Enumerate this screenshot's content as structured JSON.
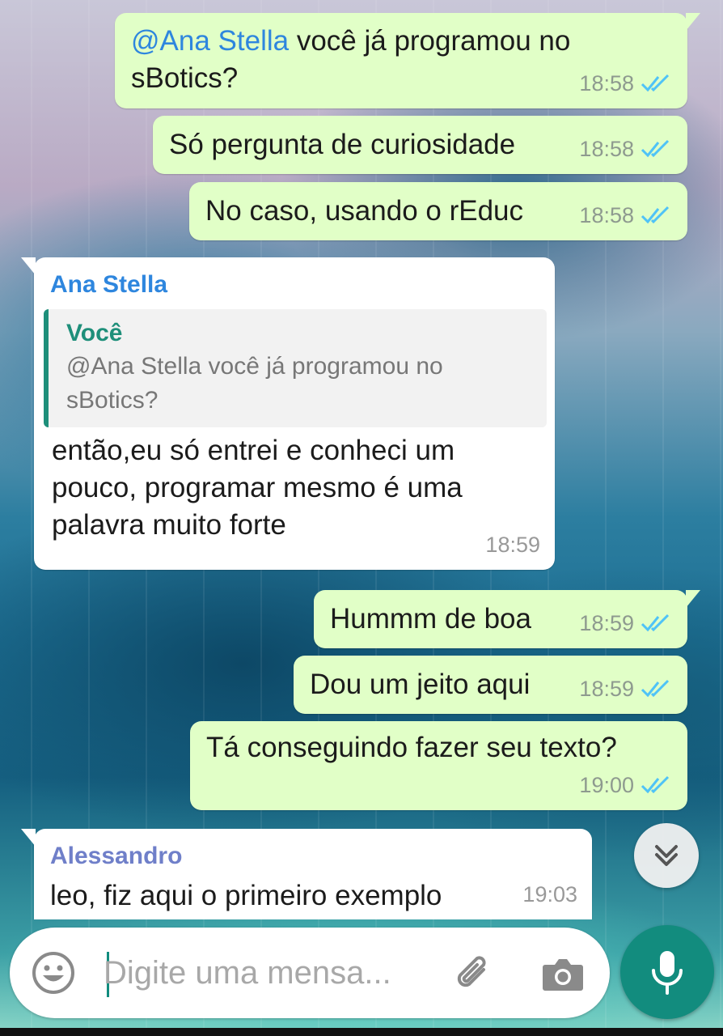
{
  "messages": [
    {
      "direction": "out",
      "mention": "@Ana Stella",
      "text": " você já programou no sBotics?",
      "time": "18:58",
      "status": "read"
    },
    {
      "direction": "out",
      "text": "Só pergunta de curiosidade",
      "time": "18:58",
      "status": "read"
    },
    {
      "direction": "out",
      "text": "No caso, usando o rEduc",
      "time": "18:58",
      "status": "read"
    },
    {
      "direction": "in",
      "sender": "Ana Stella",
      "sender_color": "#2e86de",
      "quote": {
        "author": "Você",
        "text": "@Ana Stella você já programou no sBotics?"
      },
      "text": "então,eu só entrei e conheci um pouco, programar mesmo é uma palavra muito forte",
      "time": "18:59"
    },
    {
      "direction": "out",
      "text": "Hummm de boa",
      "time": "18:59",
      "status": "read"
    },
    {
      "direction": "out",
      "text": "Dou um jeito aqui",
      "time": "18:59",
      "status": "read"
    },
    {
      "direction": "out",
      "text": "Tá conseguindo fazer seu texto?",
      "time": "19:00",
      "status": "read"
    },
    {
      "direction": "in",
      "sender": "Alessandro",
      "sender_color": "#6f7fc9",
      "text": "leo, fiz aqui o primeiro exemplo",
      "time": "19:03"
    }
  ],
  "composer": {
    "placeholder": "Digite uma mensa..."
  },
  "icons": {
    "emoji": "emoji-icon",
    "attach": "paperclip-icon",
    "camera": "camera-icon",
    "mic": "microphone-icon",
    "scroll": "double-chevron-down-icon",
    "ticks": "double-check-icon"
  },
  "colors": {
    "outgoing_bubble": "#e1ffc7",
    "incoming_bubble": "#ffffff",
    "read_ticks": "#4fc3f7",
    "accent": "#128c7e"
  }
}
